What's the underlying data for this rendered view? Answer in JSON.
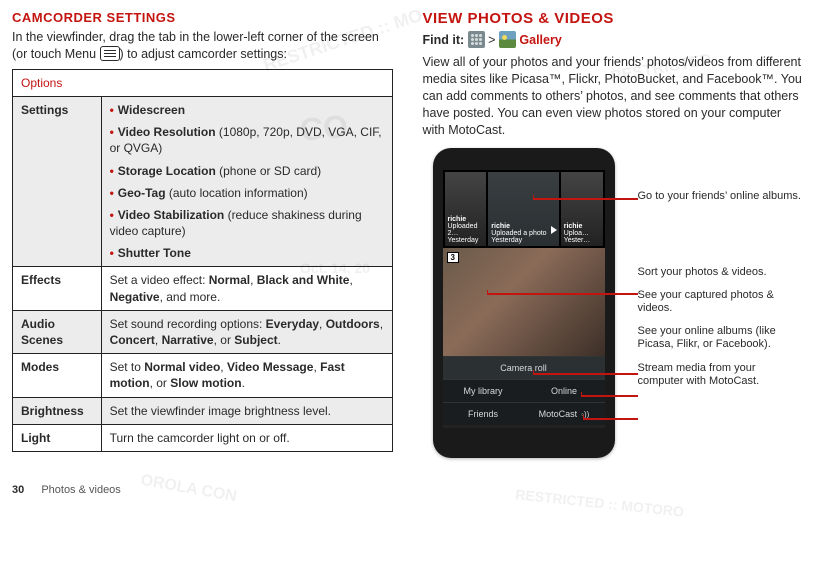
{
  "left": {
    "heading": "CAMCORDER SETTINGS",
    "intro_pre": "In the viewfinder, drag the tab in the lower-left corner of the screen (or touch Menu ",
    "intro_post": ") to adjust camcorder settings:",
    "table_header": "Options",
    "rows": {
      "settings_label": "Settings",
      "settings": {
        "widescreen": "Widescreen",
        "vres_b": "Video Resolution",
        "vres_t": " (1080p, 720p, DVD, VGA, CIF, or QVGA)",
        "stor_b": "Storage Location",
        "stor_t": " (phone or SD card)",
        "geo_b": "Geo-Tag",
        "geo_t": " (auto location information)",
        "stab_b": "Video Stabilization",
        "stab_t": " (reduce shakiness during video capture)",
        "shutter": "Shutter Tone"
      },
      "effects_label": "Effects",
      "effects_pre": "Set a video effect: ",
      "effects_b1": "Normal",
      "effects_s1": ", ",
      "effects_b2": "Black and White",
      "effects_s2": ", ",
      "effects_b3": "Negative",
      "effects_post": ", and more.",
      "audio_label": "Audio Scenes",
      "audio_pre": "Set sound recording options: ",
      "audio_b1": "Everyday",
      "audio_s1": ", ",
      "audio_b2": "Outdoors",
      "audio_s2": ", ",
      "audio_b3": "Concert",
      "audio_s3": ", ",
      "audio_b4": "Narrative",
      "audio_s4": ", or ",
      "audio_b5": "Subject",
      "audio_post": ".",
      "modes_label": "Modes",
      "modes_pre": "Set to ",
      "modes_b1": "Normal video",
      "modes_s1": ", ",
      "modes_b2": "Video Message",
      "modes_s2": ", ",
      "modes_b3": "Fast motion",
      "modes_s3": ", or ",
      "modes_b4": "Slow motion",
      "modes_post": ".",
      "bright_label": "Brightness",
      "bright_text": "Set the viewfinder image brightness level.",
      "light_label": "Light",
      "light_text": "Turn the camcorder light on or off."
    }
  },
  "right": {
    "heading": "VIEW PHOTOS & VIDEOS",
    "findit_label": "Find it:",
    "findit_sep": " > ",
    "findit_app": "Gallery",
    "para": "View all of your photos and your friends’ photos/videos from different media sites like Picasa™, Flickr, PhotoBucket, and Facebook™. You can add comments to others’ photos, and see comments that others have posted. You can even view photos stored on your computer with MotoCast.",
    "phone": {
      "tile1_name": "richie",
      "tile1_line": "Uploaded 2…",
      "tile1_when": "Yesterday",
      "tile2_name": "richie",
      "tile2_line": "Uploaded a photo",
      "tile2_when": "Yesterday",
      "tile3_name": "richie",
      "tile3_line": "Uploa…",
      "tile3_when": "Yester…",
      "badge": "3",
      "nav_camera": "Camera roll",
      "nav_lib": "My library",
      "nav_online": "Online",
      "nav_friends": "Friends",
      "nav_moto": "MotoCast"
    },
    "callouts": {
      "c1": "Go to your friends’ online albums.",
      "c2": "Sort your photos & videos.",
      "c3": "See your captured photos & videos.",
      "c4": "See your online albums (like Picasa, Flikr, or Facebook).",
      "c5": "Stream media from your computer with MotoCast."
    }
  },
  "footer": {
    "page": "30",
    "section": "Photos & videos"
  },
  "watermarks": {
    "w1": "RESTRICTED :: MO",
    "w2": "CO",
    "w3": "Oct. 14, 20",
    "w4": "OROLA CON",
    "w5": "RESTRICTED :: MOTORO",
    "w6": "RESTRICTED"
  }
}
